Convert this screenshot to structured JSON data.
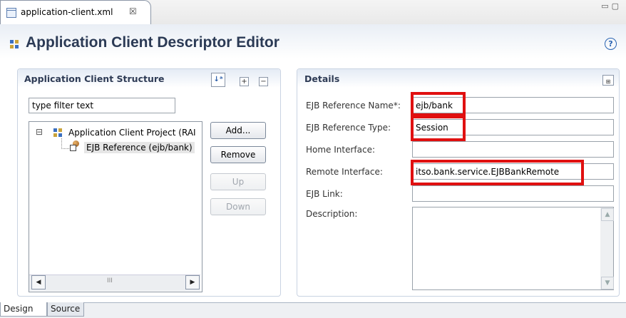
{
  "editor_tab": {
    "file_name": "application-client.xml",
    "close_glyph": "☒"
  },
  "editor": {
    "title": "Application Client Descriptor Editor",
    "help_glyph": "?"
  },
  "structure": {
    "title": "Application Client Structure",
    "filter_value": "type filter text",
    "tree": [
      {
        "label": "Application Client Project (RAI",
        "expander": "⊟"
      },
      {
        "label": "EJB Reference (ejb/bank)"
      }
    ],
    "buttons": {
      "add": "Add...",
      "remove": "Remove",
      "up": "Up",
      "down": "Down"
    },
    "scroll_thumb": "III"
  },
  "details": {
    "title": "Details",
    "fields": [
      {
        "label": "EJB Reference Name*:",
        "value": "ejb/bank",
        "highlighted": true
      },
      {
        "label": "EJB Reference Type:",
        "value": "Session",
        "highlighted": true
      },
      {
        "label": "Home Interface:",
        "value": ""
      },
      {
        "label": "Remote Interface:",
        "value": "itso.bank.service.EJBBankRemote",
        "highlighted": true
      },
      {
        "label": "EJB Link:",
        "value": ""
      },
      {
        "label": "Description:",
        "value": ""
      }
    ]
  },
  "bottom_tabs": {
    "design": "Design",
    "source": "Source"
  },
  "colors": {
    "highlight": "#e01010",
    "title_text": "#2b3a55"
  }
}
